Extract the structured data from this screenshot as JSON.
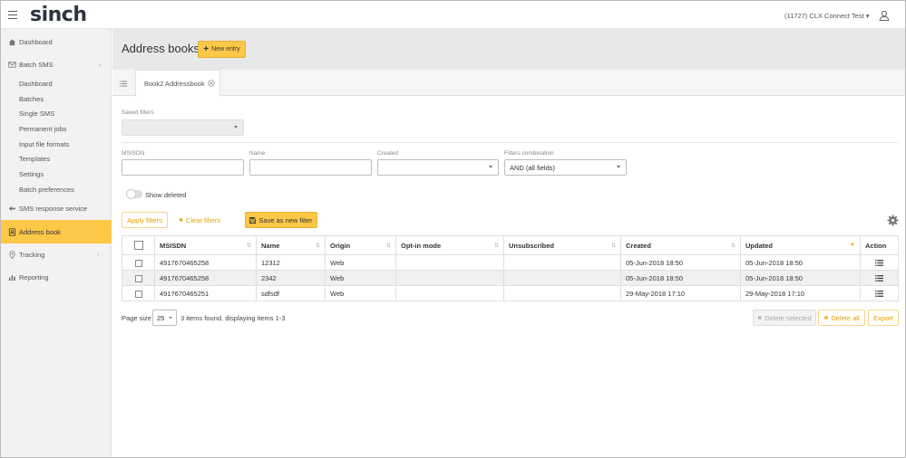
{
  "header": {
    "logo": "sinch",
    "account": "(11727) CLX Connect Test",
    "account_caret": "▾"
  },
  "sidebar": {
    "dashboard": "Dashboard",
    "batch_sms": "Batch SMS",
    "batch_sms_chevron": "⌄",
    "batch_sub": [
      "Dashboard",
      "Batches",
      "Single SMS",
      "Permanent jobs",
      "Input file formats",
      "Templates",
      "Settings",
      "Batch preferences"
    ],
    "sms_response": "SMS response service",
    "address_book": "Address book",
    "tracking": "Tracking",
    "tracking_chevron": "‹",
    "reporting": "Reporting"
  },
  "page": {
    "title": "Address books",
    "new_entry": "New entry",
    "new_entry_icon": "+"
  },
  "tabs": {
    "active": "Book2 Addressbook"
  },
  "filters": {
    "saved_filters_label": "Saved filters",
    "msisdn_label": "MSISDN",
    "name_label": "Name",
    "created_label": "Created",
    "combination_label": "Filters combination",
    "combination_value": "AND (all fields)",
    "show_deleted": "Show deleted",
    "apply": "Apply filters",
    "clear": "Clear filters",
    "clear_icon": "✖",
    "save_new": "Save as new filter"
  },
  "table": {
    "columns": [
      "MSISDN",
      "Name",
      "Origin",
      "Opt-in mode",
      "Unsubscribed",
      "Created",
      "Updated",
      "Action"
    ],
    "rows": [
      {
        "msisdn": "4917670465258",
        "name": "12312",
        "origin": "Web",
        "optin": "",
        "unsubscribed": "",
        "created": "05-Jun-2018 18:50",
        "updated": "05-Jun-2018 18:50"
      },
      {
        "msisdn": "4917670465258",
        "name": "2342",
        "origin": "Web",
        "optin": "",
        "unsubscribed": "",
        "created": "05-Jun-2018 18:50",
        "updated": "05-Jun-2018 18:50"
      },
      {
        "msisdn": "4917670465251",
        "name": "sdfsdf",
        "origin": "Web",
        "optin": "",
        "unsubscribed": "",
        "created": "29-May-2018 17:10",
        "updated": "29-May-2018 17:10"
      }
    ],
    "sort_icon": "⇅",
    "sort_active_icon": "▼"
  },
  "footer": {
    "page_size_label": "Page size",
    "page_size": "25",
    "found": "3 items found, displaying items 1-3",
    "delete_selected": "Delete selected",
    "delete_all": "Delete all",
    "export": "Export",
    "delete_icon": "✖"
  },
  "colors": {
    "accent": "#fdc848",
    "accent_text": "#e5a100"
  }
}
